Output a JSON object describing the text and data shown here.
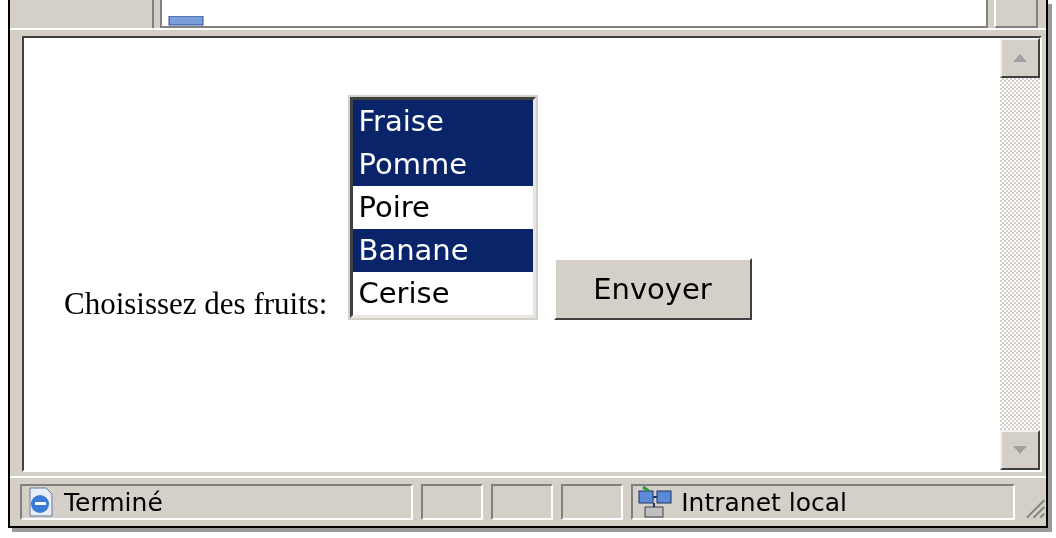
{
  "page": {
    "label": "Choisissez des fruits:",
    "fruits": [
      {
        "label": "Fraise",
        "selected": true
      },
      {
        "label": "Pomme",
        "selected": true
      },
      {
        "label": "Poire",
        "selected": false
      },
      {
        "label": "Banane",
        "selected": true
      },
      {
        "label": "Cerise",
        "selected": false
      }
    ],
    "submit": "Envoyer"
  },
  "status_bar": {
    "status": "Terminé",
    "zone": "Intranet local"
  }
}
